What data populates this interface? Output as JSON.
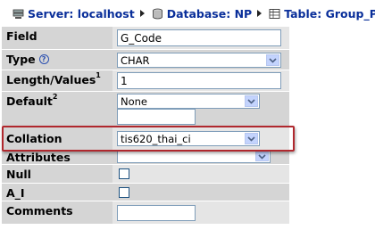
{
  "breadcrumb": {
    "server": "Server: localhost",
    "database": "Database: NP",
    "table": "Table: Group_Pro"
  },
  "fields": {
    "field": {
      "label": "Field",
      "value": "G_Code"
    },
    "type": {
      "label": "Type",
      "value": "CHAR"
    },
    "length": {
      "label": "Length/Values",
      "sup": "1",
      "value": "1"
    },
    "default": {
      "label": "Default",
      "sup": "2",
      "value": "None",
      "extra_value": ""
    },
    "collation": {
      "label": "Collation",
      "value": "tis620_thai_ci"
    },
    "attributes": {
      "label": "Attributes",
      "value": ""
    },
    "null": {
      "label": "Null",
      "checked": false
    },
    "ai": {
      "label": "A_I",
      "checked": false
    },
    "comments": {
      "label": "Comments",
      "value": ""
    }
  },
  "icons": [
    "server-icon",
    "database-icon",
    "table-icon",
    "help-icon",
    "dropdown-arrow-icon"
  ],
  "colors": {
    "link": "#0a2f9a",
    "label_bg": "#d5d5d5",
    "value_bg": "#e5e5e5",
    "highlight": "#b0282e"
  }
}
